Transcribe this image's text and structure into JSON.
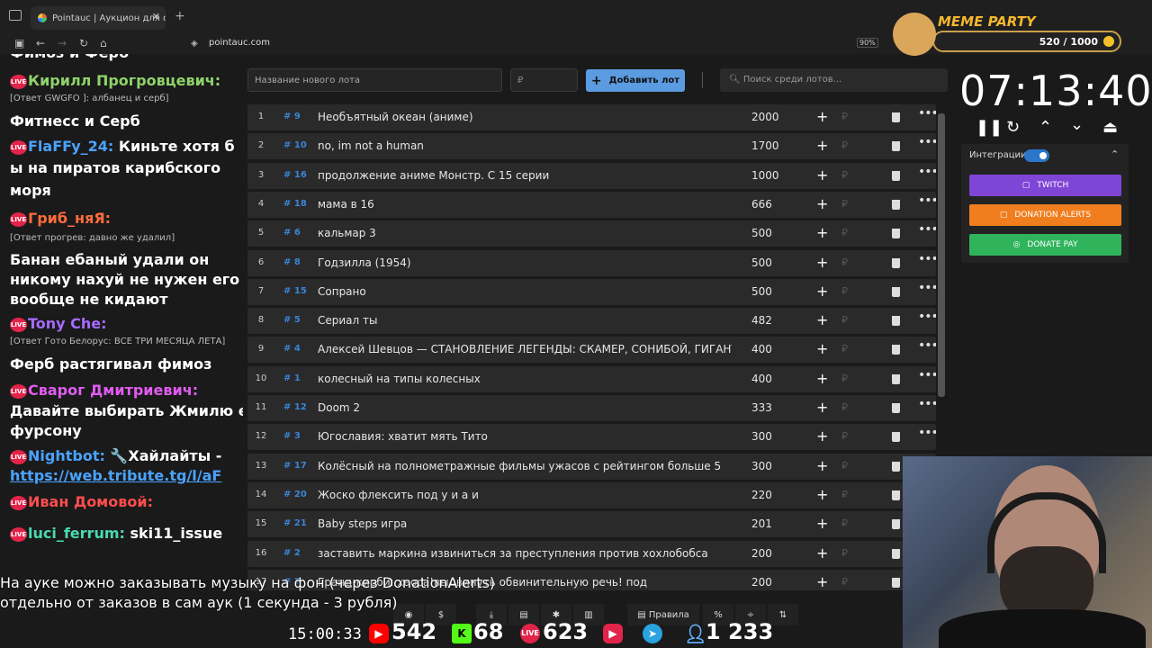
{
  "browser": {
    "tab_title": "Pointauc | Аукцион для стриме",
    "url": "pointauc.com",
    "zoom": "90%"
  },
  "chat": {
    "lines": [
      {
        "kind": "msg",
        "text": "Фимоз и Ферб"
      },
      {
        "kind": "name",
        "name": "Кирилл Прогровцевич:",
        "color": "#8fd36a"
      },
      {
        "kind": "reply",
        "text": "[Ответ GWGFO ]: албанец и серб]"
      },
      {
        "kind": "msg",
        "text": "Фитнесс и Серб"
      },
      {
        "kind": "name",
        "name": "FlaFFy_24:",
        "color": "#4aa3ff",
        "after": " Киньте хотя б"
      },
      {
        "kind": "msg",
        "text": "ы на пиратов карибского"
      },
      {
        "kind": "msg",
        "text": "моря"
      },
      {
        "kind": "name",
        "name": "Гриб_няЯ:",
        "color": "#ff6b3d"
      },
      {
        "kind": "reply",
        "text": "[Ответ прогрев: давно же удалил]"
      },
      {
        "kind": "msg",
        "text": "Банан ебаный удали он"
      },
      {
        "kind": "msg",
        "text": "никому нахуй не нужен его"
      },
      {
        "kind": "msg",
        "text": "вообще не кидают"
      },
      {
        "kind": "name",
        "name": "Tony Che:",
        "color": "#a66bff"
      },
      {
        "kind": "reply",
        "text": "[Ответ Гото Белорус: ВСЕ ТРИ МЕСЯЦА ЛЕТА]"
      },
      {
        "kind": "msg",
        "text": "Ферб растягивал фимоз"
      },
      {
        "kind": "name",
        "name": "Сварог Дмитриевич:",
        "color": "#e05cf0"
      },
      {
        "kind": "msg",
        "text": "Давайте выбирать Жмилю его"
      },
      {
        "kind": "msg",
        "text": "фурсону"
      },
      {
        "kind": "name",
        "name": "Nightbot:",
        "color": "#4aa3ff",
        "after": " 🔧Хайлайты -"
      },
      {
        "kind": "link",
        "text": "https://web.tribute.tg/l/aF"
      },
      {
        "kind": "name",
        "name": "Иван Домовой:",
        "color": "#ff4d4d"
      },
      {
        "kind": "name",
        "name": "luci_ferrum:",
        "color": "#4ad9b0",
        "after": " ski11_issue"
      }
    ],
    "live_badge": "LIVE"
  },
  "auction": {
    "lot_placeholder": "Название нового лота",
    "price_placeholder": "₽",
    "add_button": "Добавить лот",
    "search_placeholder": "Поиск среди лотов...",
    "lots": [
      {
        "n": "1",
        "id": "# 9",
        "title": "Необъятный океан (аниме)",
        "value": "2000"
      },
      {
        "n": "2",
        "id": "# 10",
        "title": "no, im not a human",
        "value": "1700"
      },
      {
        "n": "3",
        "id": "# 16",
        "title": "продолжение аниме Монстр. С 15 серии",
        "value": "1000"
      },
      {
        "n": "4",
        "id": "# 18",
        "title": "мама в 16",
        "value": "666"
      },
      {
        "n": "5",
        "id": "# 6",
        "title": "кальмар 3",
        "value": "500"
      },
      {
        "n": "6",
        "id": "# 8",
        "title": "Годзилла (1954)",
        "value": "500"
      },
      {
        "n": "7",
        "id": "# 15",
        "title": "Сопрано",
        "value": "500"
      },
      {
        "n": "8",
        "id": "# 5",
        "title": "Сериал ты",
        "value": "482"
      },
      {
        "n": "9",
        "id": "# 4",
        "title": "Алексей Шевцов — СТАНОВЛЕНИЕ ЛЕГЕНДЫ: СКАМЕР, СОНИБОЙ, ГИГАНТ |",
        "value": "400"
      },
      {
        "n": "10",
        "id": "# 1",
        "title": "колесный на типы колесных",
        "value": "400"
      },
      {
        "n": "11",
        "id": "# 12",
        "title": "Doom 2",
        "value": "333"
      },
      {
        "n": "12",
        "id": "# 3",
        "title": "Югославия: хватит мять Тито",
        "value": "300"
      },
      {
        "n": "13",
        "id": "# 17",
        "title": "Колёсный на полнометражные фильмы ужасов с рейтингом больше 5",
        "value": "300"
      },
      {
        "n": "14",
        "id": "# 20",
        "title": "Жоско флексить под у и а и",
        "value": "220"
      },
      {
        "n": "15",
        "id": "# 21",
        "title": "Baby steps игра",
        "value": "201"
      },
      {
        "n": "16",
        "id": "# 2",
        "title": "заставить маркина извиниться за преступления против хохлобобса",
        "value": "200"
      },
      {
        "n": "17",
        "id": "# 7",
        "title": "Гранд-кирби: хаоса!выдвинуть обвинительную речь! под",
        "value": "200"
      }
    ]
  },
  "timer": {
    "value": "07:13:40"
  },
  "integrations": {
    "label": "Интеграции",
    "twitch": "TWITCH",
    "donation_alerts": "DONATION ALERTS",
    "donate_pay": "DONATE PAY",
    "twitch_color": "#7f45d6",
    "da_color": "#f07e1f",
    "dp_color": "#2fb45c"
  },
  "meme_party": {
    "title": "MEME PARTY",
    "progress": "520 / 1000"
  },
  "caption": {
    "line1": "На ауке можно заказывать музыку на фон (через DonationAlerts)",
    "line2": "отдельно от заказов в сам аук (1 секунда - 3 рубля)"
  },
  "toolbar": {
    "rules": "Правила"
  },
  "stats": {
    "clock": "15:00:33",
    "youtube": "542",
    "kick": "68",
    "live": "623",
    "telegram_icon": "telegram-icon",
    "viewers": "1 233"
  }
}
